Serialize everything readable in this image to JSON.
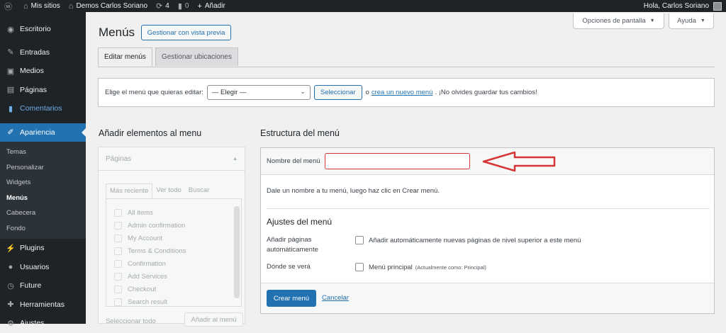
{
  "adminbar": {
    "my_sites": "Mis sitios",
    "site_name": "Demos Carlos Soriano",
    "updates_count": "4",
    "comments_count": "0",
    "new_label": "Añadir",
    "greeting": "Hola, Carlos Soriano"
  },
  "sidebar": {
    "items": [
      {
        "label": "Escritorio",
        "icon": "dashboard-icon"
      },
      {
        "label": "Entradas",
        "icon": "pin-icon"
      },
      {
        "label": "Medios",
        "icon": "media-icon"
      },
      {
        "label": "Páginas",
        "icon": "page-icon"
      },
      {
        "label": "Comentarios",
        "icon": "comment-icon"
      },
      {
        "label": "Apariencia",
        "icon": "brush-icon"
      }
    ],
    "sub_items": [
      "Temas",
      "Personalizar",
      "Widgets",
      "Menús",
      "Cabecera",
      "Fondo"
    ],
    "bottom_items": [
      {
        "label": "Plugins",
        "icon": "plugin-icon"
      },
      {
        "label": "Usuarios",
        "icon": "users-icon"
      },
      {
        "label": "Future",
        "icon": "future-icon"
      },
      {
        "label": "Herramientas",
        "icon": "tools-icon"
      },
      {
        "label": "Ajustes",
        "icon": "settings-icon"
      }
    ]
  },
  "header": {
    "title": "Menús",
    "preview_button": "Gestionar con vista previa",
    "screen_options": "Opciones de pantalla",
    "help": "Ayuda"
  },
  "tabs": [
    "Editar menús",
    "Gestionar ubicaciones"
  ],
  "select_menu": {
    "label": "Elige el menú que quieras editar:",
    "value": "— Elegir —",
    "button": "Seleccionar",
    "or": "o",
    "create_link": "crea un nuevo menú",
    "reminder": ". ¡No olvides guardar tus cambios!"
  },
  "add_items": {
    "heading": "Añadir elementos al menu",
    "panel_title": "Páginas",
    "tabs": [
      "Más reciente",
      "Ver todo",
      "Buscar"
    ],
    "pages": [
      "All items",
      "Admin confirmation",
      "My Account",
      "Terms & Conditions",
      "Confirmation",
      "Add Services",
      "Checkout",
      "Search result"
    ],
    "select_all": "Seleccionar todo",
    "add_button": "Añadir al menú"
  },
  "structure": {
    "heading": "Estructura del menú",
    "name_label": "Nombre del menú",
    "name_value": "",
    "hint": "Dale un nombre a tu menú, luego haz clic en Crear menú.",
    "settings_heading": "Ajustes del menú",
    "auto_add_label": "Añadir páginas automáticamente",
    "auto_add_option": "Añadir automáticamente nuevas páginas de nivel superior a este menú",
    "display_label": "Dónde se verá",
    "display_option": "Menú principal",
    "display_note": "(Actualmente como: Principal)",
    "create_button": "Crear menú",
    "cancel_link": "Cancelar"
  },
  "colors": {
    "accent": "#2271b1",
    "admin_dark": "#1d2327",
    "annotation_arrow": "#d63638"
  }
}
